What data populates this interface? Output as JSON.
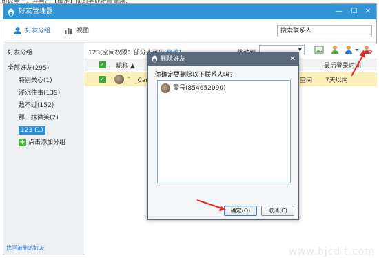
{
  "tutorial_text": "可以点击，并点击【确定】即可完成批量删除。",
  "window": {
    "title": "好友管理器",
    "controls": [
      "—",
      "☐",
      "✕"
    ]
  },
  "toolbar": {
    "tab_friend_groups": "好友分组",
    "tab_view": "视图",
    "search_placeholder": "搜索联系人"
  },
  "sidebar": {
    "title": "好友分组",
    "items": [
      {
        "label": "全部好友(295)"
      },
      {
        "label": "特别关心(1)"
      },
      {
        "label": "浮沉往事(139)"
      },
      {
        "label": "敌不过(152)"
      },
      {
        "label": "那一抹微笑(2)"
      },
      {
        "label": "123 (1)"
      }
    ],
    "add_group": "点击添加分组",
    "find_deleted": "找回被删的好友"
  },
  "main": {
    "group_info_prefix": "123(空间权限：部分人可见 ",
    "group_info_link": "修改",
    "group_info_suffix": ")",
    "move_to_label": "移动到",
    "columns": {
      "nickname": "昵称 ▲",
      "last_login": "最后登录时间"
    },
    "row": {
      "nickname": "゛_Cand",
      "space": "空间",
      "last_login": "7天以内"
    }
  },
  "dialog": {
    "title": "删除好友",
    "question": "你确定要删除以下联系人吗?",
    "contact": "零号(854652090)",
    "confirm_label": "确定(O)",
    "cancel_label": "取消(C)"
  },
  "watermark": "www.bjcdit.com",
  "colors": {
    "titlebar": "#2f95d6",
    "dialog_titlebar": "#5a6b80",
    "selected_row": "#fbf0b8",
    "annotation_arrow": "#e8281f"
  }
}
